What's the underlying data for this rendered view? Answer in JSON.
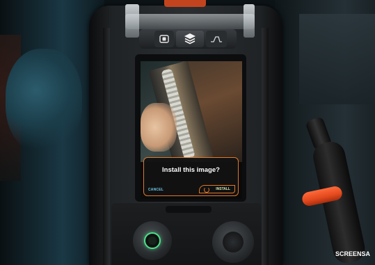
{
  "dialog": {
    "title": "Install this image?",
    "cancel_label": "CANCEL",
    "install_label": "INSTALL"
  },
  "toolbar": {
    "icons": [
      "image-icon",
      "layers-icon",
      "waveform-icon"
    ]
  },
  "watermark": "SCREENSA",
  "colors": {
    "accent_orange": "#e0782a",
    "cancel_blue": "#6ec7e8",
    "install_text": "#d6e6ae",
    "knob_ring_green": "#4ce08a",
    "torch_ring": "#e2481d"
  }
}
